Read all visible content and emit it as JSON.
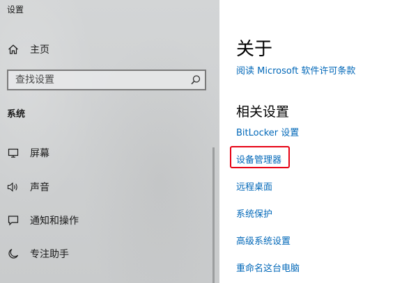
{
  "window": {
    "title": "设置"
  },
  "sidebar": {
    "home": {
      "label": "主页",
      "icon": "home-icon"
    },
    "search": {
      "placeholder": "查找设置",
      "value": "",
      "icon": "search-icon"
    },
    "section_header": "系统",
    "items": [
      {
        "label": "屏幕",
        "icon": "monitor-icon"
      },
      {
        "label": "声音",
        "icon": "speaker-icon"
      },
      {
        "label": "通知和操作",
        "icon": "notification-icon"
      },
      {
        "label": "专注助手",
        "icon": "moon-icon"
      }
    ]
  },
  "main": {
    "title": "关于",
    "license_link": "阅读 Microsoft 软件许可条款",
    "related_settings": {
      "heading": "相关设置",
      "links": [
        "BitLocker 设置",
        "设备管理器",
        "远程桌面",
        "系统保护",
        "高级系统设置",
        "重命名这台电脑"
      ]
    }
  },
  "colors": {
    "link": "#0067b8",
    "highlight": "#e60012",
    "sidebar_bg": "#d0d2d3"
  }
}
